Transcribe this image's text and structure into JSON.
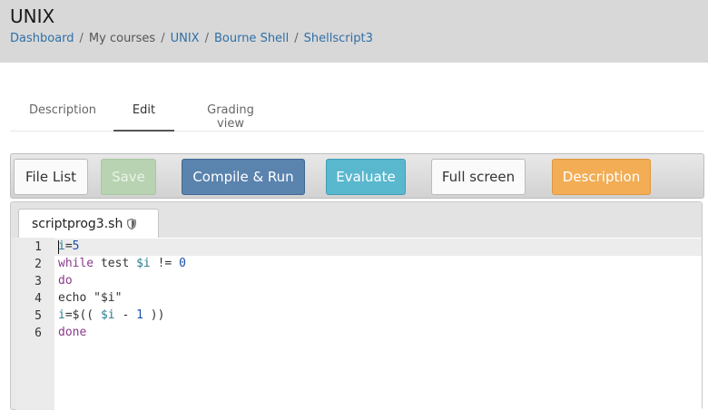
{
  "header": {
    "course_title": "UNIX",
    "breadcrumb": [
      "Dashboard",
      "My courses",
      "UNIX",
      "Bourne Shell",
      "Shellscript3"
    ]
  },
  "tabs": [
    {
      "label": "Description"
    },
    {
      "label": "Edit"
    },
    {
      "label": "Grading view"
    }
  ],
  "active_tab": "Edit",
  "toolbar": {
    "file_list": "File List",
    "save": "Save",
    "compile_run": "Compile & Run",
    "evaluate": "Evaluate",
    "full_screen": "Full screen",
    "description": "Description"
  },
  "colors": {
    "save_disabled": "#b7d3b2",
    "compile_run": "#5a83ad",
    "evaluate": "#5ab8ce",
    "description": "#f2ad55"
  },
  "editor": {
    "filename": "scriptprog3.sh",
    "lock_icon": "shield-icon",
    "line_numbers": [
      "1",
      "2",
      "3",
      "4",
      "5",
      "6"
    ],
    "lines": [
      {
        "parts": [
          {
            "t": "i",
            "c": "var"
          },
          {
            "t": "=",
            "c": ""
          },
          {
            "t": "5",
            "c": "num"
          }
        ]
      },
      {
        "parts": [
          {
            "t": "while",
            "c": "kw"
          },
          {
            "t": " test ",
            "c": ""
          },
          {
            "t": "$i",
            "c": "var"
          },
          {
            "t": " != ",
            "c": ""
          },
          {
            "t": "0",
            "c": "num"
          }
        ]
      },
      {
        "parts": [
          {
            "t": "do",
            "c": "kw"
          }
        ]
      },
      {
        "parts": [
          {
            "t": "echo",
            "c": ""
          },
          {
            "t": " \"$i\"",
            "c": "str"
          }
        ]
      },
      {
        "parts": [
          {
            "t": "i",
            "c": "var"
          },
          {
            "t": "=$(( ",
            "c": ""
          },
          {
            "t": "$i",
            "c": "var"
          },
          {
            "t": " - ",
            "c": ""
          },
          {
            "t": "1",
            "c": "num"
          },
          {
            "t": " ))",
            "c": ""
          }
        ]
      },
      {
        "parts": [
          {
            "t": "done",
            "c": "kw"
          }
        ]
      }
    ]
  }
}
